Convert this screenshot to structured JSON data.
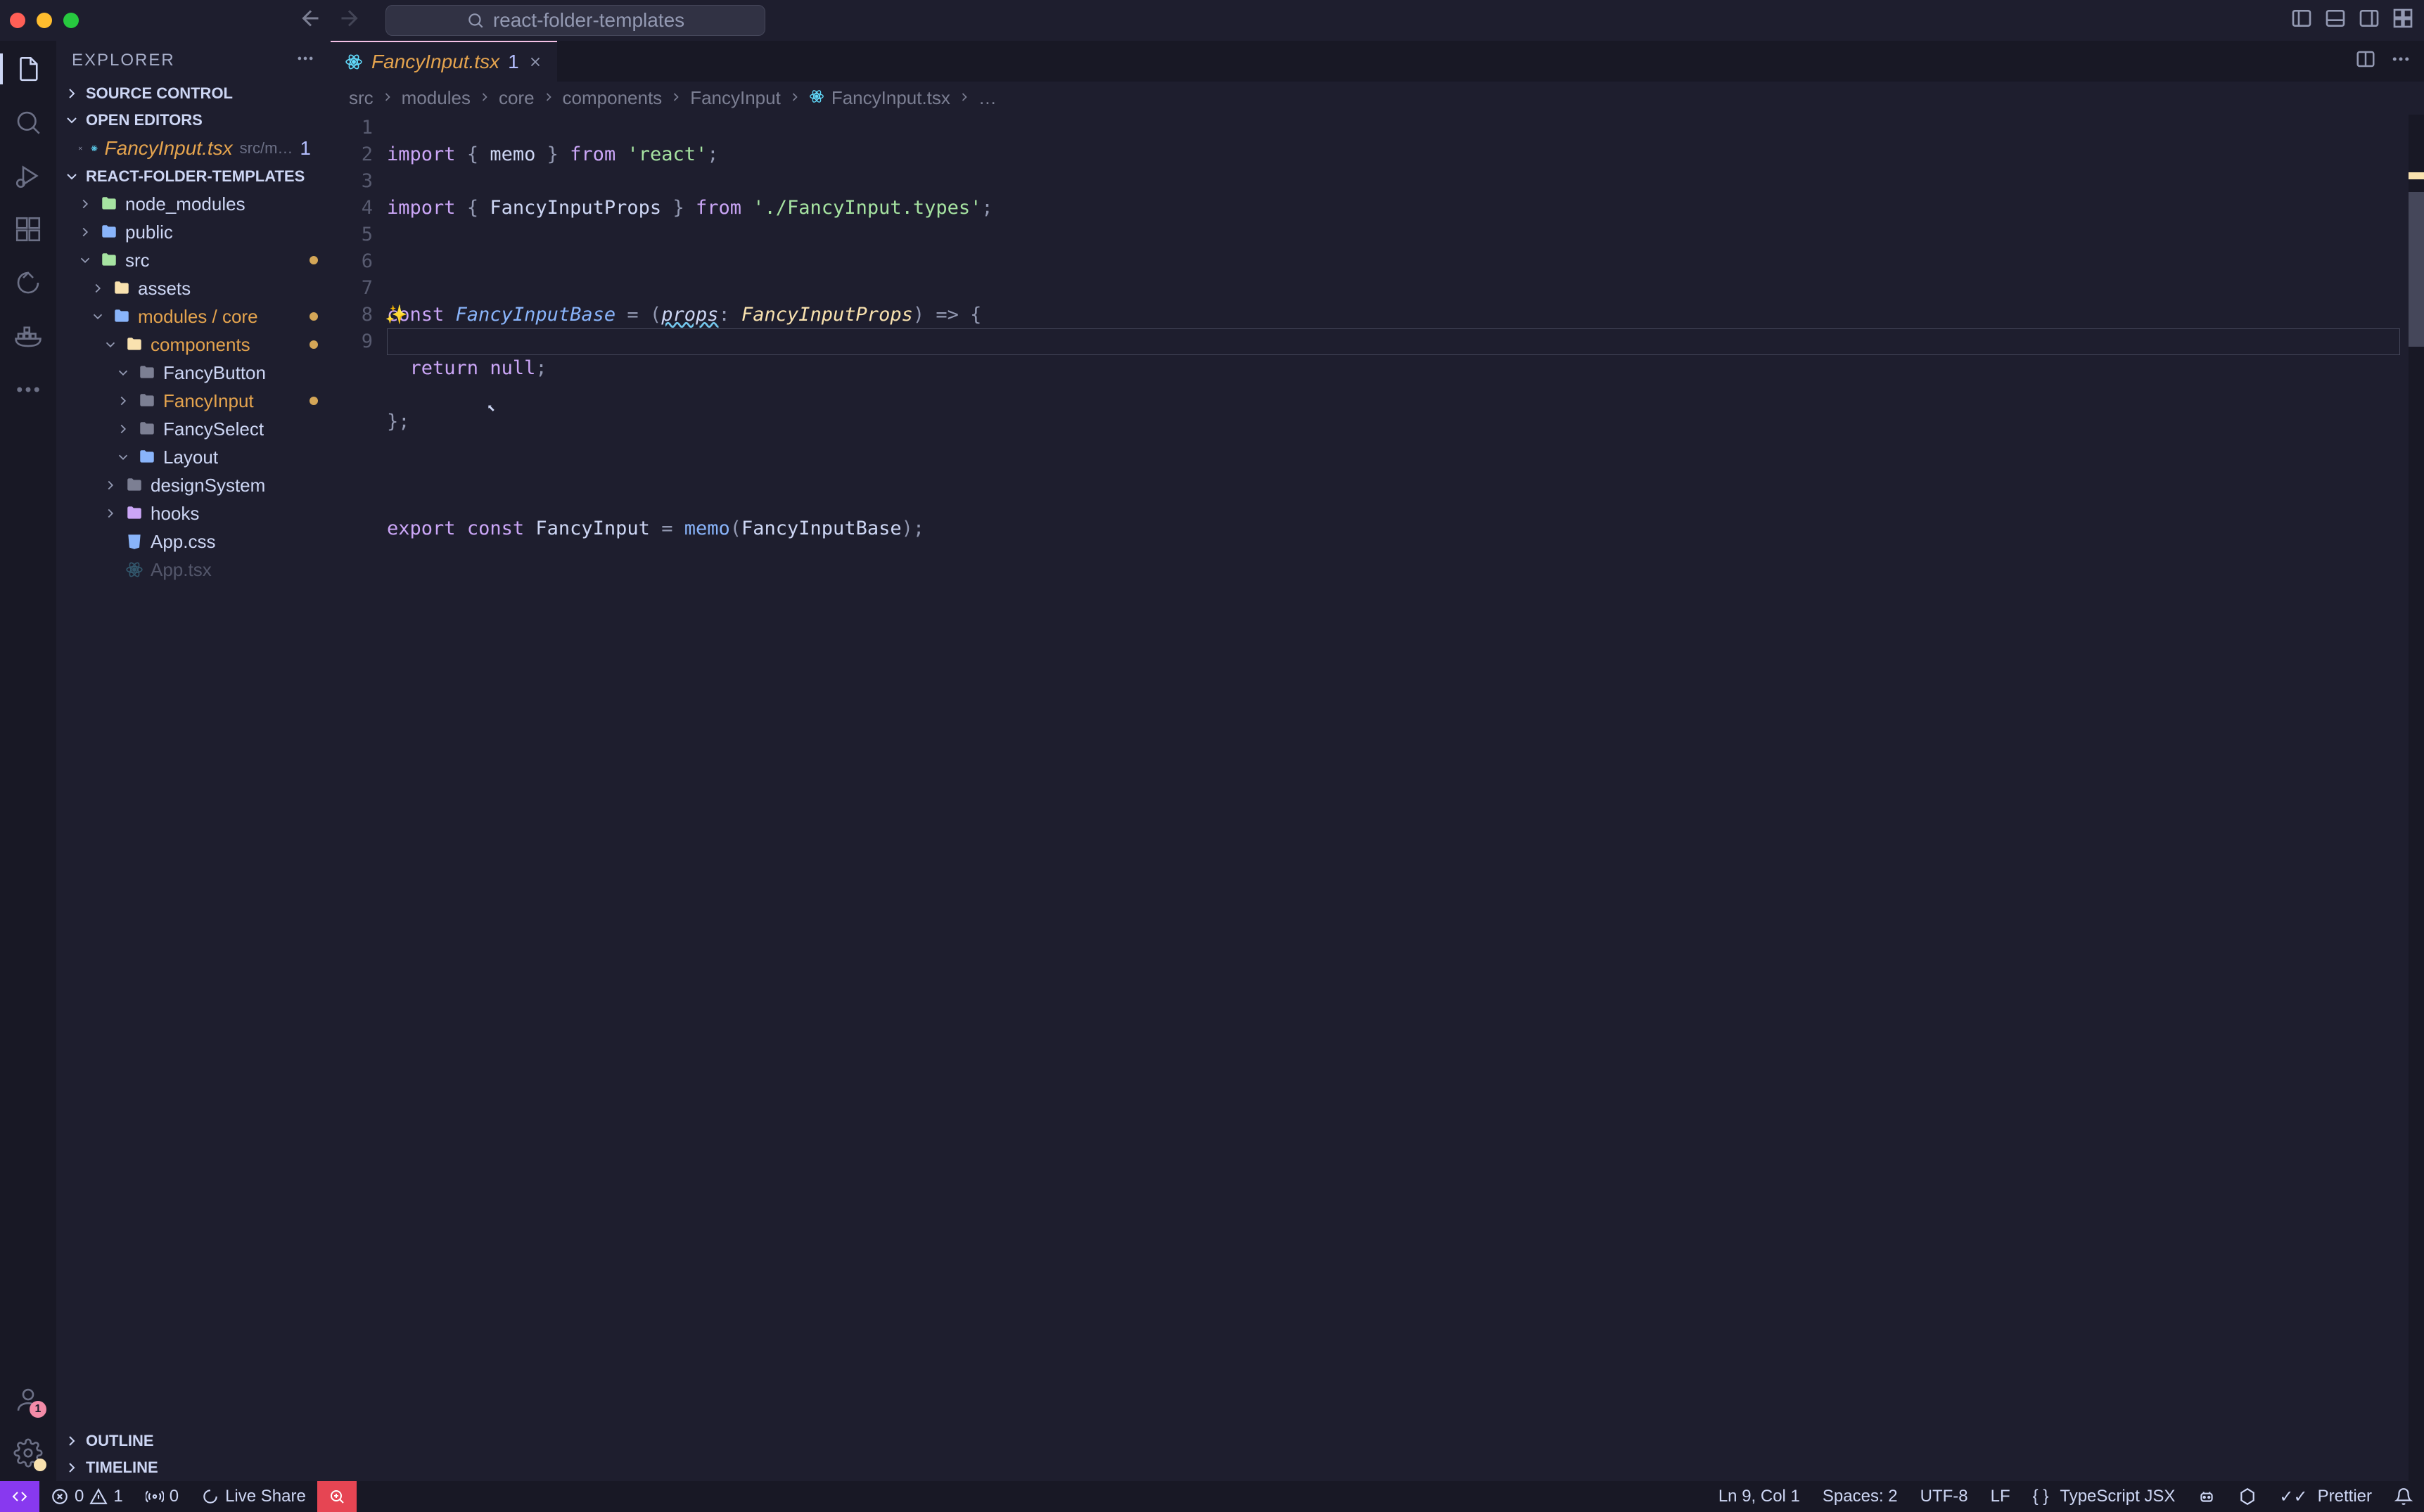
{
  "titlebar": {
    "search": "react-folder-templates"
  },
  "sidebar": {
    "title": "EXPLORER",
    "sections": {
      "source_control": "SOURCE CONTROL",
      "open_editors": "OPEN EDITORS",
      "project": "REACT-FOLDER-TEMPLATES",
      "outline": "OUTLINE",
      "timeline": "TIMELINE"
    },
    "open_editor": {
      "name": "FancyInput.tsx",
      "path": "src/m…",
      "count": "1"
    },
    "tree": [
      {
        "label": "node_modules",
        "icon": "folder-node",
        "indent": 1,
        "chev": "right",
        "orange": false
      },
      {
        "label": "public",
        "icon": "folder-pub",
        "indent": 1,
        "chev": "right",
        "orange": false
      },
      {
        "label": "src",
        "icon": "folder-src",
        "indent": 1,
        "chev": "down",
        "orange": false,
        "mod": true
      },
      {
        "label": "assets",
        "icon": "folder-assets",
        "indent": 2,
        "chev": "right",
        "orange": false
      },
      {
        "label": "modules / core",
        "icon": "folder-mod",
        "indent": 2,
        "chev": "down",
        "orange": true,
        "mod": true
      },
      {
        "label": "components",
        "icon": "folder-comp",
        "indent": 3,
        "chev": "down",
        "orange": true,
        "mod": true
      },
      {
        "label": "FancyButton",
        "icon": "folder",
        "indent": 4,
        "chev": "down",
        "orange": false
      },
      {
        "label": "FancyInput",
        "icon": "folder",
        "indent": 4,
        "chev": "right",
        "orange": true,
        "mod": true
      },
      {
        "label": "FancySelect",
        "icon": "folder",
        "indent": 4,
        "chev": "right",
        "orange": false
      },
      {
        "label": "Layout",
        "icon": "folder-layout",
        "indent": 4,
        "chev": "down",
        "orange": false
      },
      {
        "label": "designSystem",
        "icon": "folder",
        "indent": 3,
        "chev": "right",
        "orange": false
      },
      {
        "label": "hooks",
        "icon": "folder-hooks",
        "indent": 3,
        "chev": "right",
        "orange": false
      },
      {
        "label": "App.css",
        "icon": "css",
        "indent": 3,
        "chev": "",
        "orange": false
      },
      {
        "label": "App.tsx",
        "icon": "react",
        "indent": 3,
        "chev": "",
        "orange": false,
        "cut": true
      }
    ]
  },
  "tab": {
    "name": "FancyInput.tsx",
    "count": "1"
  },
  "breadcrumb": [
    "src",
    "modules",
    "core",
    "components",
    "FancyInput",
    "FancyInput.tsx",
    "…"
  ],
  "code": {
    "lines": [
      "1",
      "2",
      "3",
      "4",
      "5",
      "6",
      "7",
      "8",
      "9"
    ]
  },
  "status": {
    "errors": "0",
    "warnings": "1",
    "ports": "0",
    "liveshare": "Live Share",
    "pos": "Ln 9, Col 1",
    "spaces": "Spaces: 2",
    "encoding": "UTF-8",
    "eol": "LF",
    "lang": "TypeScript JSX",
    "prettier": "Prettier"
  },
  "activity_badge": "1"
}
